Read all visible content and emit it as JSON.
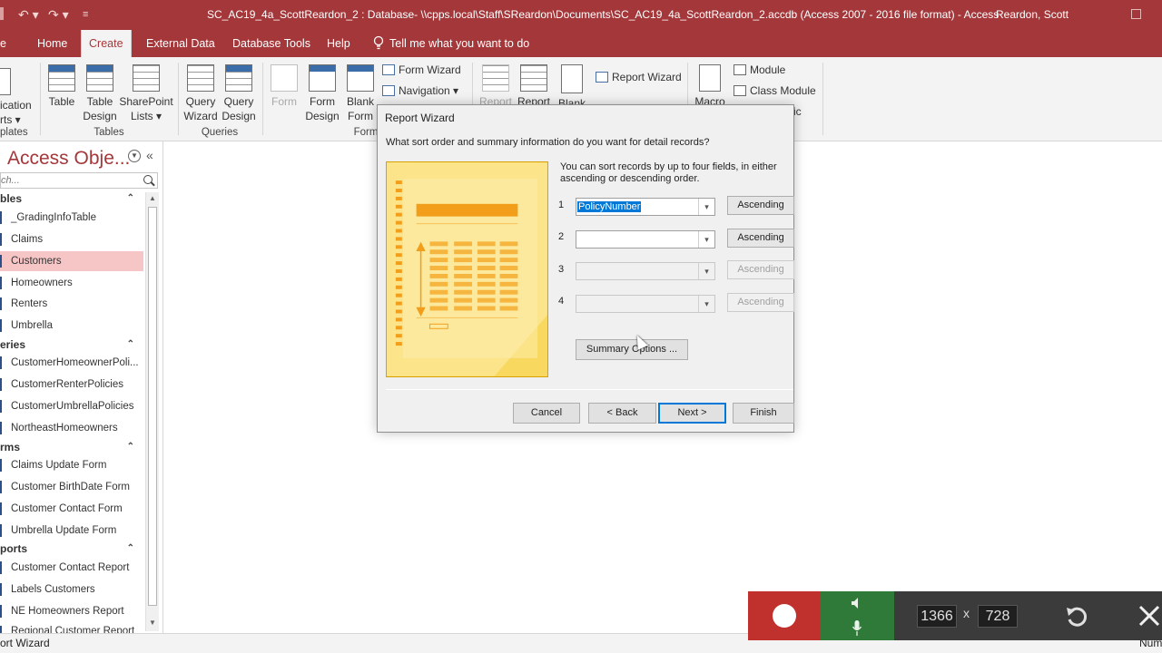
{
  "window": {
    "title": "SC_AC19_4a_ScottReardon_2 : Database- \\\\cpps.local\\Staff\\SReardon\\Documents\\SC_AC19_4a_ScottReardon_2.accdb (Access 2007 - 2016 file format)  -  Access",
    "user": "Reardon, Scott"
  },
  "tabs": {
    "file": "e",
    "home": "Home",
    "create": "Create",
    "external": "External Data",
    "dbtools": "Database Tools",
    "help": "Help",
    "tellme": "Tell me what you want to do"
  },
  "ribbon": {
    "app_parts_1": "ication",
    "app_parts_2": "rts ▾",
    "templates_group": "plates",
    "table": "Table",
    "table_design_1": "Table",
    "table_design_2": "Design",
    "sharepoint_1": "SharePoint",
    "sharepoint_2": "Lists ▾",
    "tables_group": "Tables",
    "query_wizard_1": "Query",
    "query_wizard_2": "Wizard",
    "query_design_1": "Query",
    "query_design_2": "Design",
    "queries_group": "Queries",
    "form": "Form",
    "form_design_1": "Form",
    "form_design_2": "Design",
    "blank_form_1": "Blank",
    "blank_form_2": "Form",
    "form_wizard": "Form Wizard",
    "navigation": "Navigation ▾",
    "forms_group": "Form",
    "report": "Report",
    "report_design": "Report",
    "blank_report": "Blank",
    "report_wizard": "Report Wizard",
    "macro": "Macro",
    "module": "Module",
    "class_module": "Class Module",
    "vb": "ic"
  },
  "nav": {
    "title": "Access Obje...",
    "search_placeholder": "ch...",
    "sections": {
      "tables": "bles",
      "queries": "eries",
      "forms": "rms",
      "reports": "ports"
    },
    "tables": [
      "_GradingInfoTable",
      "Claims",
      "Customers",
      "Homeowners",
      "Renters",
      "Umbrella"
    ],
    "queries": [
      "CustomerHomeownerPoli...",
      "CustomerRenterPolicies",
      "CustomerUmbrellaPolicies",
      "NortheastHomeowners"
    ],
    "forms": [
      "Claims Update Form",
      "Customer BirthDate Form",
      "Customer Contact Form",
      "Umbrella Update Form"
    ],
    "reports": [
      "Customer Contact Report",
      "Labels Customers",
      "NE Homeowners Report",
      "Regional Customer Report"
    ]
  },
  "dialog": {
    "title": "Report Wizard",
    "question": "What sort order and summary information do you want for detail records?",
    "description": "You can sort records by up to four fields, in either ascending or descending order.",
    "sorts": [
      {
        "num": "1",
        "value": "PolicyNumber",
        "order": "Ascending"
      },
      {
        "num": "2",
        "value": "",
        "order": "Ascending"
      },
      {
        "num": "3",
        "value": "",
        "order": "Ascending"
      },
      {
        "num": "4",
        "value": "",
        "order": "Ascending"
      }
    ],
    "summary_button": "Summary Options ...",
    "cancel": "Cancel",
    "back": "< Back",
    "next": "Next >",
    "finish": "Finish"
  },
  "statusbar": {
    "left": "ort Wizard",
    "right": "Num"
  },
  "recorder": {
    "width": "1366",
    "times": "x",
    "height": "728"
  },
  "colors": {
    "accent": "#a4373a",
    "selected_nav": "#f6c6c6",
    "recorder_red": "#c0302c",
    "recorder_green": "#2f7a38"
  }
}
